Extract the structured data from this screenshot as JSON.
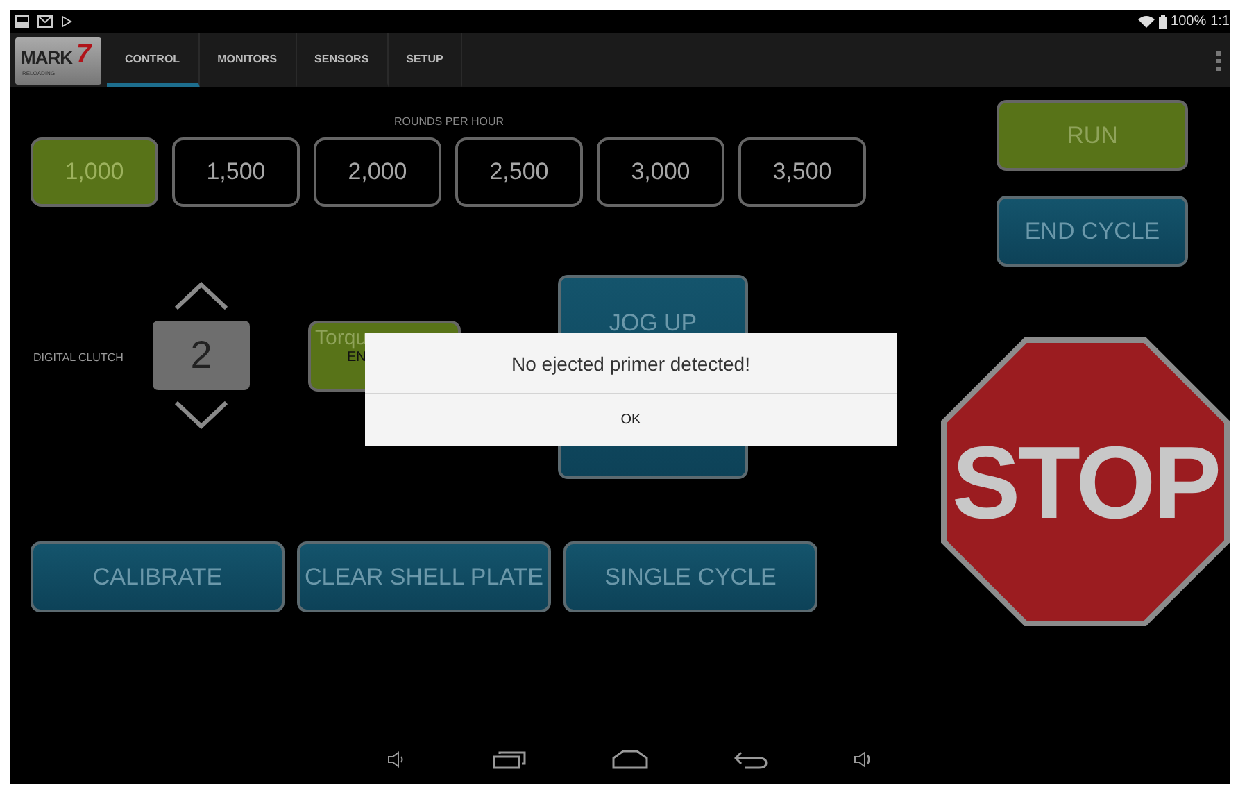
{
  "status_bar": {
    "battery_text": "100%",
    "time": "1:1"
  },
  "action_bar": {
    "logo": {
      "text": "MARK",
      "number": "7",
      "tagline": "RELOADING"
    },
    "tabs": [
      {
        "label": "CONTROL",
        "selected": true
      },
      {
        "label": "MONITORS",
        "selected": false
      },
      {
        "label": "SENSORS",
        "selected": false
      },
      {
        "label": "SETUP",
        "selected": false
      }
    ]
  },
  "rounds_per_hour": {
    "label": "ROUNDS PER HOUR",
    "options": [
      {
        "label": "1,000",
        "selected": true
      },
      {
        "label": "1,500",
        "selected": false
      },
      {
        "label": "2,000",
        "selected": false
      },
      {
        "label": "2,500",
        "selected": false
      },
      {
        "label": "3,000",
        "selected": false
      },
      {
        "label": "3,500",
        "selected": false
      }
    ]
  },
  "digital_clutch": {
    "label": "DIGITAL CLUTCH",
    "value": "2"
  },
  "torque_button": {
    "label": "Torqu",
    "sublabel": "EN"
  },
  "jog_button": {
    "label": "JOG UP"
  },
  "actions": [
    "CALIBRATE",
    "CLEAR SHELL PLATE",
    "SINGLE CYCLE"
  ],
  "run_button": {
    "label": "RUN"
  },
  "end_cycle_button": {
    "label": "END CYCLE"
  },
  "stop_sign": {
    "label": "STOP"
  },
  "dialog": {
    "message": "No ejected primer detected!",
    "button": "OK"
  }
}
